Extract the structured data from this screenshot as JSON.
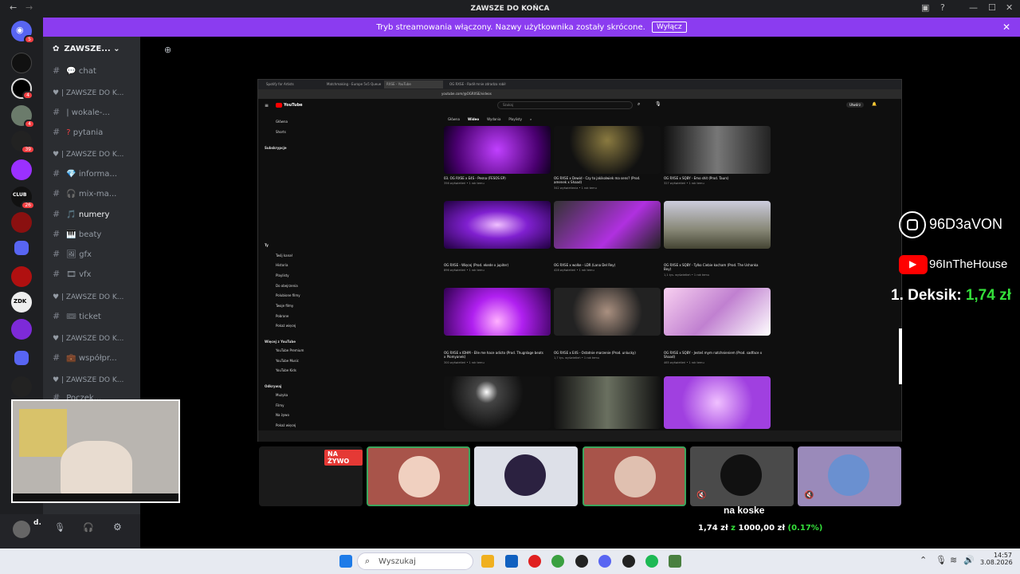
{
  "window": {
    "title": "ZAWSZE DO KOŃCA"
  },
  "banner": {
    "text": "Tryb streamowania włączony. Nazwy użytkownika zostały skrócone.",
    "button": "Wyłącz"
  },
  "rail": {
    "badges": [
      "5",
      "4",
      "4",
      "39",
      "26"
    ]
  },
  "server": {
    "name": "ZAWSZE..."
  },
  "channels": [
    {
      "label": "chat",
      "icon": "💬"
    },
    {
      "label": "wokale-...",
      "icon": "|"
    },
    {
      "label": "pytania",
      "icon": "?"
    },
    {
      "label": "informa...",
      "icon": "💎"
    },
    {
      "label": "mix-ma...",
      "icon": "🎧"
    },
    {
      "label": "numery",
      "icon": "🎵"
    },
    {
      "label": "beaty",
      "icon": "🎹"
    },
    {
      "label": "gfx",
      "icon": "🖼"
    },
    {
      "label": "vfx",
      "icon": "🎞"
    },
    {
      "label": "ticket",
      "icon": "🎟"
    },
    {
      "label": "współpr...",
      "icon": "💼"
    },
    {
      "label": "Poczek...",
      "icon": ""
    }
  ],
  "categories": [
    "| ZAWSZE DO K...",
    "| ZAWSZE DO K...",
    "| ZAWSZE DO K...",
    "| ZAWSZE DO K..."
  ],
  "user": {
    "name": "d."
  },
  "browser": {
    "tabs": [
      "Spotify for Artists",
      "Matchmaking - Europe 5v5 Queue",
      "RXSE - YouTube",
      "OG RXSE - Radił mnie zdradza robił"
    ],
    "url": "youtube.com/@OGRXSE/videos",
    "yt": {
      "logo": "YouTube",
      "search_placeholder": "Szukaj",
      "create": "Utwórz",
      "channel_tabs": [
        "Główna",
        "Wideo",
        "Wydania",
        "Playlisty"
      ],
      "sidebar": [
        "Główna",
        "Shorts",
        "Subskrypcje",
        "Ty",
        "Twój kanał",
        "Historia",
        "Playlisty",
        "Do obejrzenia",
        "Polubione filmy",
        "Twoje filmy",
        "Pobrane",
        "Pokaż więcej",
        "Więcej z YouTube",
        "YouTube Premium",
        "YouTube Music",
        "YouTube Kids",
        "Odkrywaj",
        "Muzyka",
        "Filmy",
        "Na żywo",
        "Pokaż więcej"
      ],
      "videos": [
        {
          "title": "03. OG RXSE x E4S - Pesna (FESOS EP)",
          "meta": "356 wyświetleń • 1 rok temu",
          "dur": "2:11"
        },
        {
          "title": "OG RXSE x Dewid - Czy to jakikolwiek ma sens? (Prod. amenek x Shaad)",
          "meta": "342 wyświetlenia • 1 rok temu",
          "dur": "2:56"
        },
        {
          "title": "OG RXSE x SQBY - Emo shit (Prod. Taurs)",
          "meta": "327 wyświetleń • 1 rok temu",
          "dur": "2:05"
        },
        {
          "title": "OG RXSE - Więcej (Prod. ekede x jupiter)",
          "meta": "896 wyświetleń • 1 rok temu",
          "dur": "1:43"
        },
        {
          "title": "OG RXSE x wolke - LDR (Lana Del Rey)",
          "meta": "428 wyświetleń • 1 rok temu",
          "dur": "2:21"
        },
        {
          "title": "OG RXSE x SQBY - Tylko Ciebie kocham (Prod. The Ushanka Boy)",
          "meta": "1,1 tys. wyświetleń • 1 rok temu",
          "dur": "2:23"
        },
        {
          "title": "OG RXSE x IDHM - Elle me hace adicto (Prod. Thugnlage beats x Plomyanek)",
          "meta": "300 wyświetleń • 1 rok temu",
          "dur": "2:18"
        },
        {
          "title": "OG RXSE x E4S - Ostatnie marzenie (Prod. unlucky)",
          "meta": "1,7 tys. wyświetleń • 1 rok temu",
          "dur": "1:55"
        },
        {
          "title": "OG RXSE x SQBY - Jesteś mym natchnieniem (Prod. sadface x Shaad)",
          "meta": "465 wyświetleń • 1 rok temu",
          "dur": "1:56"
        }
      ]
    }
  },
  "overlay": {
    "instagram": "96D3aVON",
    "youtube": "96InTheHouse",
    "donor_label": "1. Deksik:",
    "donor_amount": "1,74 zł",
    "goal_title": "na koske",
    "goal_current": "1,74 zł",
    "goal_sep": "z",
    "goal_target": "1000,00 zł",
    "goal_pct": "(0.17%)",
    "live_badge": "NA ŻYWO"
  },
  "taskbar": {
    "search": "Wyszukaj",
    "time": "14:57",
    "date": "3.08.2026"
  },
  "colors": {
    "banner": "#8b3cf0",
    "goal_green": "#34e03a",
    "live_red": "#e53935"
  }
}
